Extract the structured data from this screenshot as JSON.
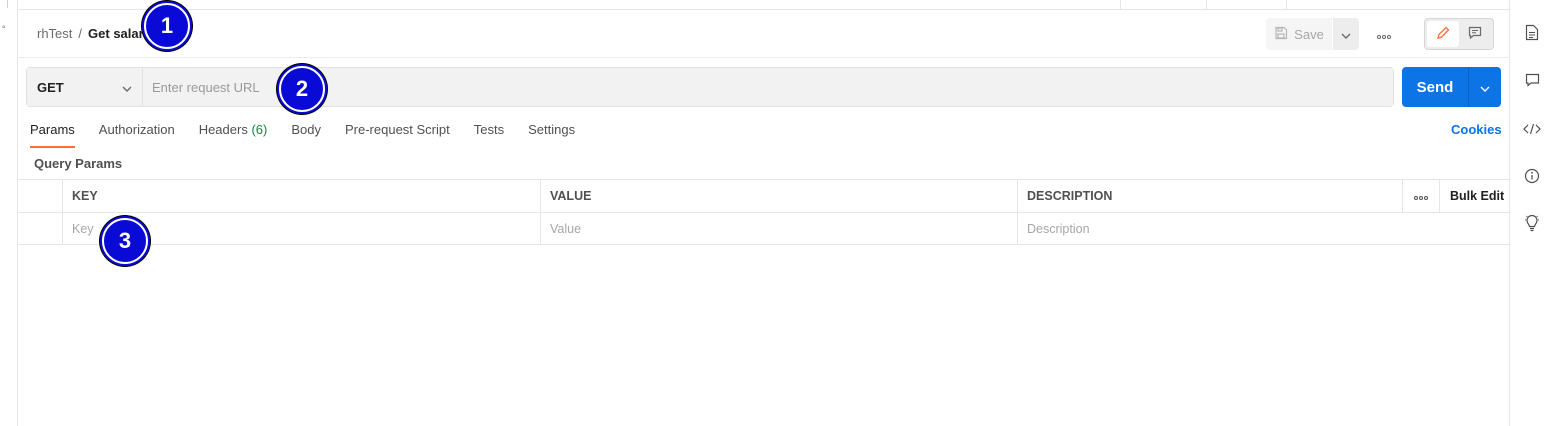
{
  "breadcrumb": {
    "collection": "rhTest",
    "separator": "/",
    "request_name": "Get salar"
  },
  "header": {
    "save_label": "Save"
  },
  "request": {
    "method": "GET",
    "url_placeholder": "Enter request URL",
    "send_label": "Send"
  },
  "tabs": [
    {
      "label": "Params",
      "active": true
    },
    {
      "label": "Authorization"
    },
    {
      "label": "Headers",
      "count": "(6)"
    },
    {
      "label": "Body"
    },
    {
      "label": "Pre-request Script"
    },
    {
      "label": "Tests"
    },
    {
      "label": "Settings"
    }
  ],
  "cookies_label": "Cookies",
  "query_params": {
    "title": "Query Params",
    "columns": {
      "key": "KEY",
      "value": "VALUE",
      "description": "DESCRIPTION",
      "bulk_edit": "Bulk Edit"
    },
    "placeholders": {
      "key": "Key",
      "value": "Value",
      "description": "Description"
    }
  },
  "annotations": [
    "1",
    "2",
    "3"
  ],
  "colors": {
    "accent": "#ff6c37",
    "primary": "#0c74e4",
    "badge": "#0a0ad6",
    "count": "#0a8a3c"
  },
  "icons": [
    "save-icon",
    "chevron-down-icon",
    "more-horizontal-icon",
    "pencil-icon",
    "comment-icon",
    "document-icon",
    "code-icon",
    "info-icon",
    "lightbulb-icon"
  ]
}
